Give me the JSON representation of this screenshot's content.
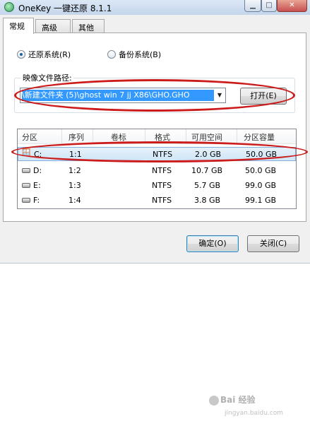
{
  "window": {
    "title": "OneKey 一键还原 8.1.1",
    "minimize_glyph": "▁",
    "maximize_glyph": "□",
    "close_glyph": "✕"
  },
  "tabs": [
    {
      "label": "常规",
      "active": true
    },
    {
      "label": "高级",
      "active": false
    },
    {
      "label": "其他",
      "active": false
    }
  ],
  "mode": {
    "restore_label": "还原系统(R)",
    "backup_label": "备份系统(B)",
    "selected": "restore"
  },
  "image_path": {
    "group_label": "映像文件路径:",
    "value": "\\新建文件夹 (5)\\ghost win 7 jj X86\\GHO.GHO",
    "open_button": "打开(E)"
  },
  "partition_table": {
    "columns": [
      "分区",
      "序列",
      "卷标",
      "格式",
      "可用空间",
      "分区容量"
    ],
    "rows": [
      {
        "drive": "C:",
        "seq": "1:1",
        "label": "",
        "format": "NTFS",
        "free": "2.0 GB",
        "capacity": "50.0 GB",
        "selected": true,
        "icon": "windows-drive-icon"
      },
      {
        "drive": "D:",
        "seq": "1:2",
        "label": "",
        "format": "NTFS",
        "free": "10.7 GB",
        "capacity": "50.0 GB",
        "selected": false,
        "icon": "drive-icon"
      },
      {
        "drive": "E:",
        "seq": "1:3",
        "label": "",
        "format": "NTFS",
        "free": "5.7 GB",
        "capacity": "99.0 GB",
        "selected": false,
        "icon": "drive-icon"
      },
      {
        "drive": "F:",
        "seq": "1:4",
        "label": "",
        "format": "NTFS",
        "free": "3.8 GB",
        "capacity": "99.1 GB",
        "selected": false,
        "icon": "drive-icon"
      }
    ]
  },
  "footer": {
    "ok_button": "确定(O)",
    "close_button": "关闭(C)"
  },
  "watermark": {
    "brand": "Bai 经验",
    "url": "jingyan.baidu.com"
  },
  "colors": {
    "annotation_red": "#cc1b1b",
    "selection_blue": "#3399ff"
  }
}
